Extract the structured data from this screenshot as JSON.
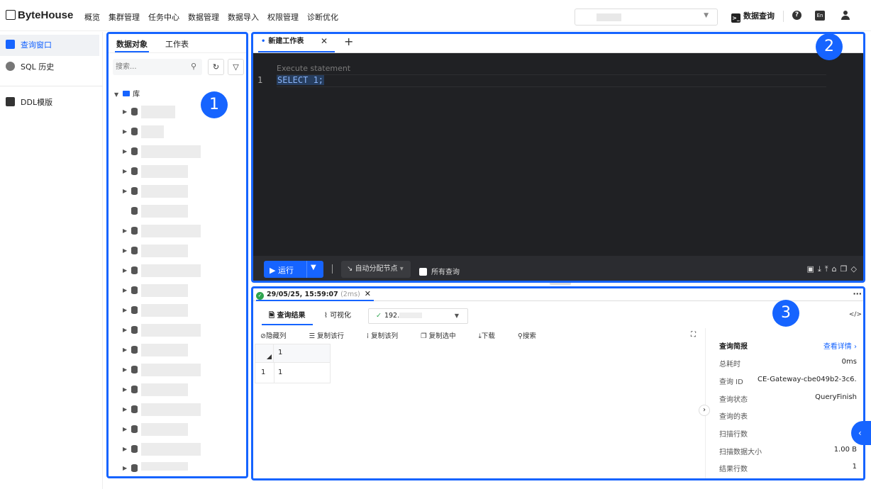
{
  "app": {
    "logo": "ByteHouse"
  },
  "nav": {
    "items": [
      "概览",
      "集群管理",
      "任务中心",
      "数据管理",
      "数据导入",
      "权限管理",
      "诊断优化"
    ]
  },
  "topbar": {
    "sql_query": "数据查询",
    "help": "?",
    "lang": "En"
  },
  "sidebar": {
    "items": [
      {
        "label": "查询窗口",
        "icon": "query-window-icon"
      },
      {
        "label": "SQL 历史",
        "icon": "history-icon"
      },
      {
        "label": "DDL模版",
        "icon": "terminal-icon"
      }
    ]
  },
  "object_panel": {
    "tabs": [
      "数据对象",
      "工作表"
    ],
    "search_placeholder": "搜索...",
    "root_label": "库"
  },
  "editor": {
    "tab_label": "新建工作表",
    "hint": "Execute statement",
    "line_number": "1",
    "code": "SELECT 1;",
    "run_label": "运行",
    "node_select": "自动分配节点",
    "all_queries": "所有查询"
  },
  "result": {
    "tab_label": "29/05/25, 15:59:07",
    "tab_duration": "(2ms)",
    "tabs": [
      "查询结果",
      "可视化"
    ],
    "node_prefix": "192.",
    "toolbar": [
      "隐藏列",
      "复制该行",
      "复制该列",
      "复制选中",
      "下载",
      "搜索"
    ],
    "grid": {
      "column": "1",
      "row_number": "1",
      "value": "1"
    },
    "summary": {
      "title": "查询简报",
      "link": "查看详情",
      "rows": [
        {
          "k": "总耗时",
          "v": "0ms"
        },
        {
          "k": "查询 ID",
          "v": "CE-Gateway-cbe049b2-3c6..."
        },
        {
          "k": "查询状态",
          "v": "QueryFinish"
        },
        {
          "k": "查询的表",
          "v": ""
        },
        {
          "k": "扫描行数",
          "v": ""
        },
        {
          "k": "扫描数据大小",
          "v": "1.00 B"
        },
        {
          "k": "结果行数",
          "v": "1"
        }
      ]
    }
  },
  "badges": [
    "1",
    "2",
    "3"
  ],
  "colors": {
    "accent": "#1664ff",
    "editor_bg": "#202124",
    "success": "#2ea44f"
  }
}
